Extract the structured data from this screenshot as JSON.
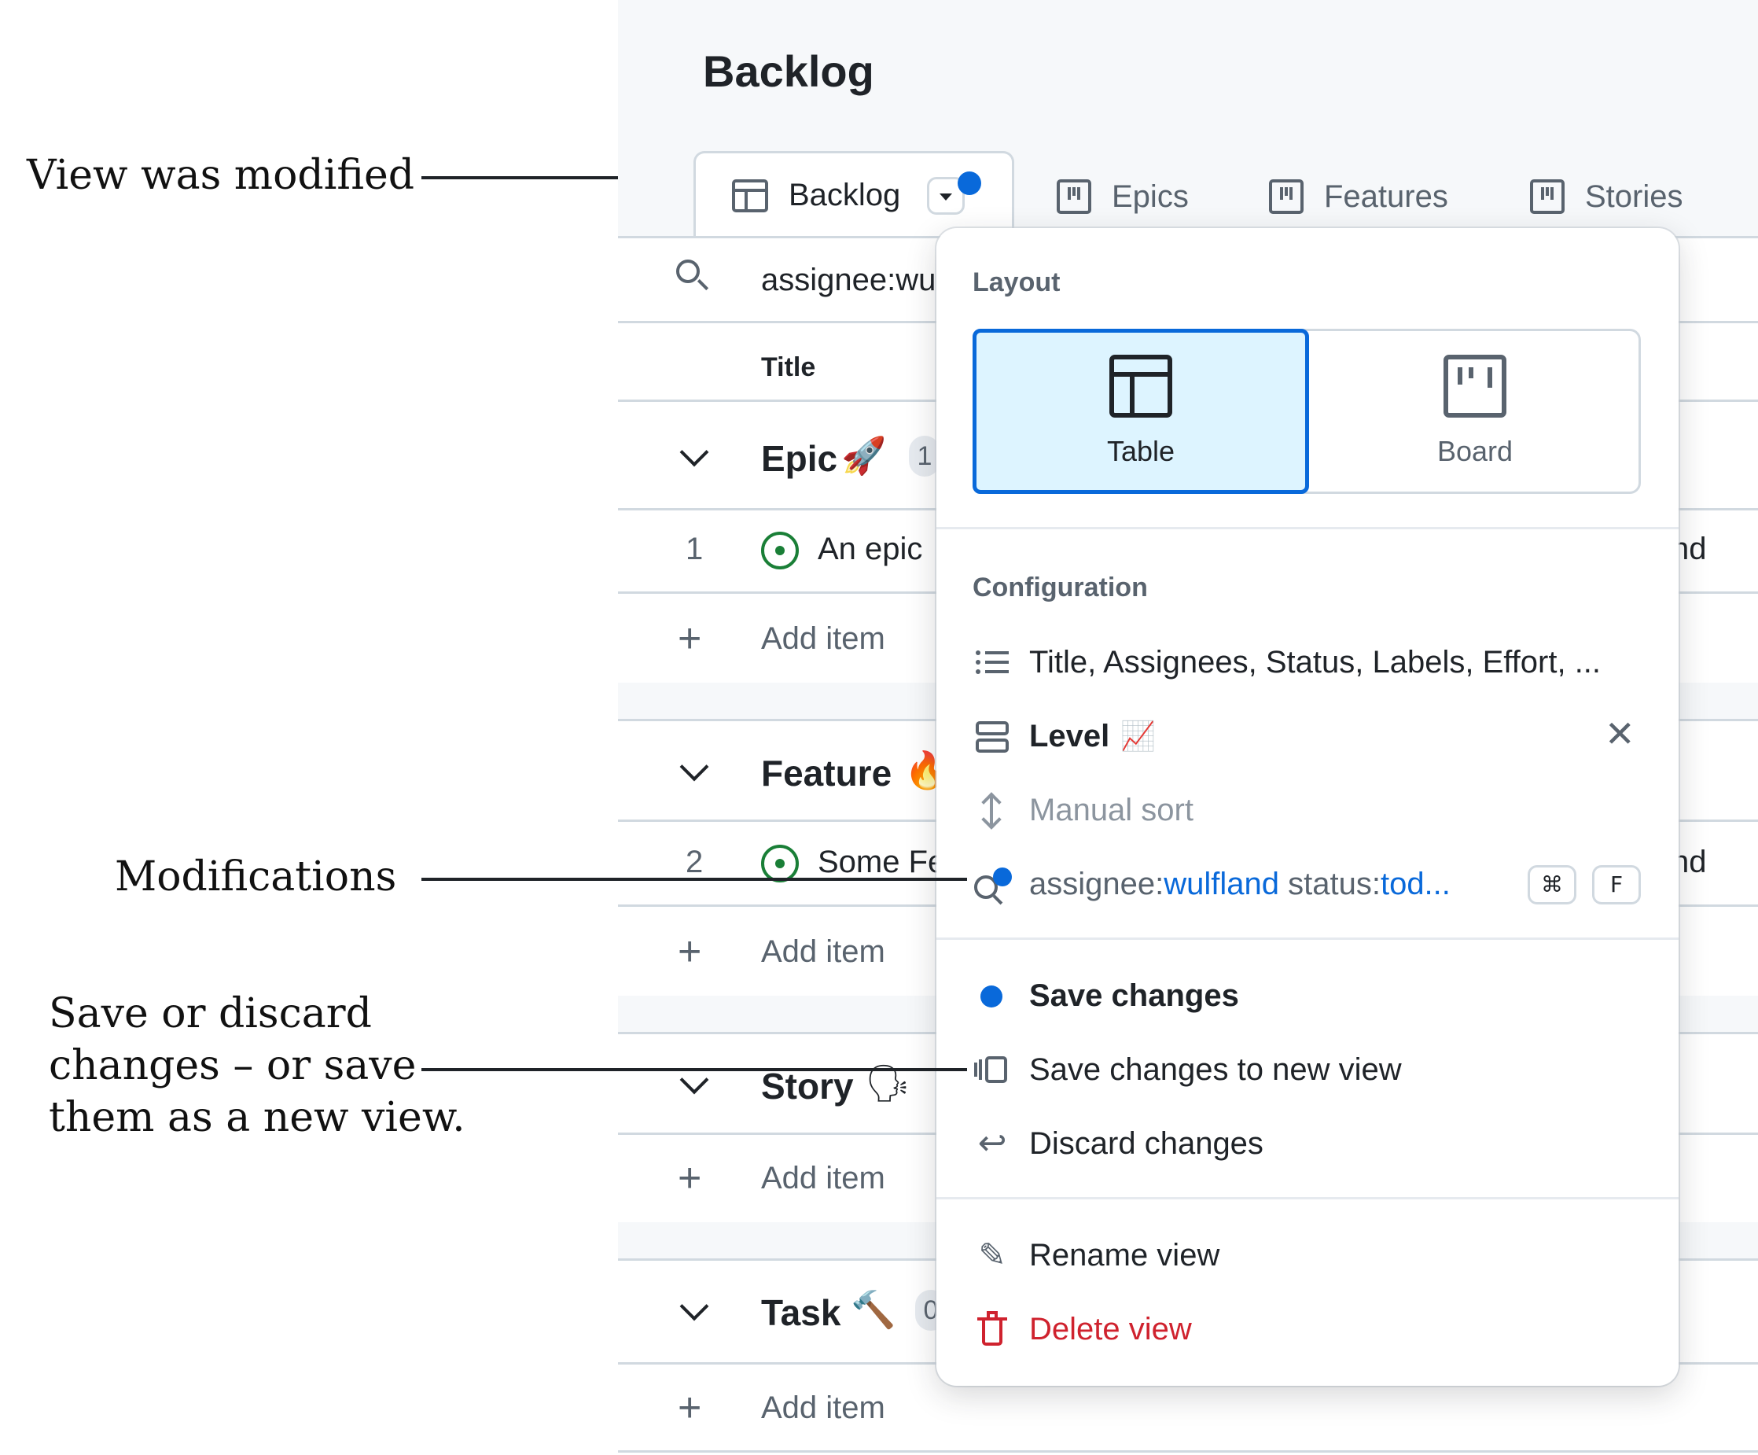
{
  "annotations": {
    "view_modified": "View was modified",
    "modifications": "Modifications",
    "save_discard": [
      "Save or discard",
      "changes – or save",
      "them as a new view."
    ]
  },
  "page": {
    "title": "Backlog"
  },
  "tabs": [
    {
      "label": "Backlog",
      "icon": "table-icon",
      "active": true
    },
    {
      "label": "Epics",
      "icon": "board-icon"
    },
    {
      "label": "Features",
      "icon": "board-icon"
    },
    {
      "label": "Stories",
      "icon": "board-icon"
    }
  ],
  "filter_bar": {
    "value": "assignee:wu"
  },
  "table": {
    "column_title": "Title",
    "groups": [
      {
        "name": "Epic",
        "emoji": "🚀",
        "count": "1",
        "rows": [
          {
            "num": "1",
            "title": "An epic",
            "trail": "nd"
          }
        ]
      },
      {
        "name": "Feature",
        "emoji": "🔥",
        "rows": [
          {
            "num": "2",
            "title": "Some Fe",
            "trail": "nd"
          }
        ]
      },
      {
        "name": "Story",
        "emoji": "🗣"
      },
      {
        "name": "Task",
        "emoji": "🔨",
        "count": "0"
      }
    ],
    "add_item_label": "Add item"
  },
  "menu": {
    "layout_label": "Layout",
    "layouts": [
      {
        "label": "Table",
        "selected": true
      },
      {
        "label": "Board",
        "selected": false
      }
    ],
    "configuration_label": "Configuration",
    "fields": "Title, Assignees, Status, Labels, Effort, ...",
    "group_by": "Level",
    "group_by_emoji": "📈",
    "sort": "Manual sort",
    "filter_prefix1": "assignee:",
    "filter_value1": "wulfland",
    "filter_prefix2": " status:",
    "filter_value2": "tod...",
    "shortcut_keys": [
      "⌘",
      "F"
    ],
    "save_changes": "Save changes",
    "save_new_view": "Save changes to new view",
    "discard_changes": "Discard changes",
    "rename_view": "Rename view",
    "delete_view": "Delete view"
  },
  "colors": {
    "accent": "#0969da",
    "danger": "#cf222e",
    "open": "#1a7f37"
  }
}
